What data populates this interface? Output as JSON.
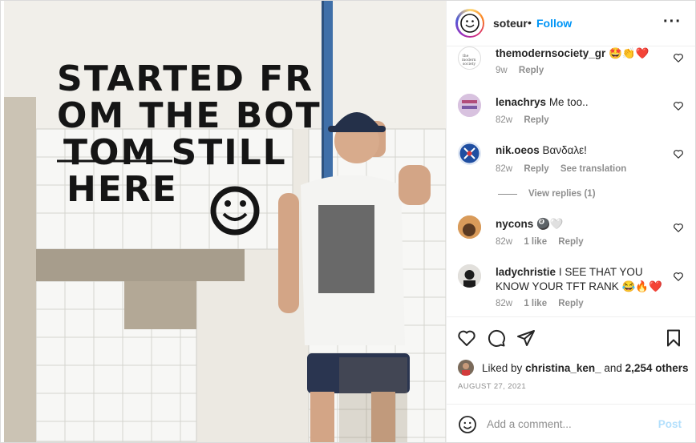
{
  "post": {
    "username": "soteur",
    "separator": "•",
    "follow_label": "Follow",
    "more_icon": "more-horizontal-icon",
    "photo_wall_text": [
      "STARTED FR",
      "OM THE BOT",
      "TOM STILL",
      "HERE"
    ]
  },
  "comments": [
    {
      "user": "themodernsociety_gr",
      "text": "🤩👏❤️",
      "time": "9w",
      "likes": "",
      "reply": "Reply",
      "translate": ""
    },
    {
      "user": "lenachrys",
      "text": "Me too..",
      "time": "82w",
      "likes": "",
      "reply": "Reply",
      "translate": ""
    },
    {
      "user": "nik.oeos",
      "text": "Βανδαλε!",
      "time": "82w",
      "likes": "",
      "reply": "Reply",
      "translate": "See translation"
    },
    {
      "user": "nycons",
      "text": "🎱🤍",
      "time": "82w",
      "likes": "1 like",
      "reply": "Reply",
      "translate": ""
    },
    {
      "user": "ladychristie",
      "text": "I SEE THAT YOU KNOW YOUR TFT RANK 😂🔥❤️",
      "time": "82w",
      "likes": "1 like",
      "reply": "Reply",
      "translate": ""
    }
  ],
  "view_replies": "View replies (1)",
  "likes": {
    "prefix": "Liked by",
    "user": "christina_ken_",
    "middle": "and",
    "others": "2,254 others"
  },
  "date": "AUGUST 27, 2021",
  "add_comment": {
    "placeholder": "Add a comment...",
    "post_label": "Post"
  },
  "colors": {
    "accent": "#0095f6",
    "muted": "#8e8e8e",
    "post_disabled": "#b2dffc",
    "heart_red": "#ed4956"
  }
}
